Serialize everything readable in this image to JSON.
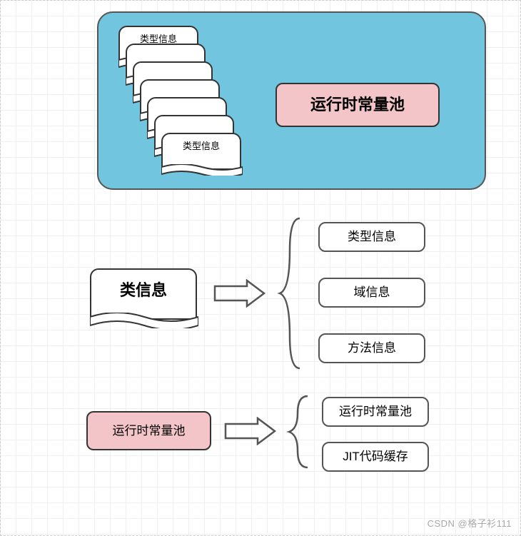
{
  "top_panel": {
    "doc_label_top": "类型信息",
    "doc_label_bottom": "类型信息",
    "pink_box": "运行时常量池"
  },
  "section1": {
    "source": "类信息",
    "items": [
      "类型信息",
      "域信息",
      "方法信息"
    ]
  },
  "section2": {
    "source": "运行时常量池",
    "items": [
      "运行时常量池",
      "JIT代码缓存"
    ]
  },
  "watermark": "CSDN @格子衫111"
}
